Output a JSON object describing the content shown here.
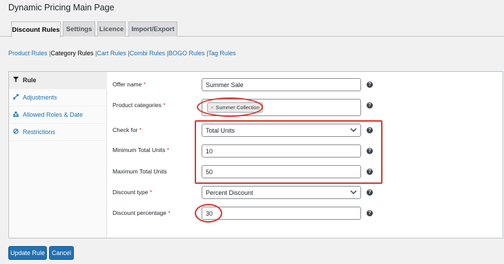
{
  "page_title": "Dynamic Pricing Main Page",
  "tabs": [
    {
      "label": "Discount Rules",
      "active": true
    },
    {
      "label": "Settings",
      "active": false
    },
    {
      "label": "Licence",
      "active": false
    },
    {
      "label": "Import/Export",
      "active": false
    }
  ],
  "subnav": {
    "product": "Product Rules",
    "category": "Category Rules",
    "cart": "Cart Rules",
    "combi": "Combi Rules",
    "bogo": "BOGO Rules",
    "tag": "Tag Rules",
    "separator": "|"
  },
  "sidebar": {
    "items": [
      {
        "label": "Rule",
        "icon": "filter-icon"
      },
      {
        "label": "Adjustments",
        "icon": "arrows-icon"
      },
      {
        "label": "Allowed Roles & Date",
        "icon": "users-icon"
      },
      {
        "label": "Restrictions",
        "icon": "ban-icon"
      }
    ]
  },
  "form": {
    "required_mark": "*",
    "help_glyph": "?",
    "offer_name": {
      "label": "Offer name",
      "value": "Summer Sale"
    },
    "product_categories": {
      "label": "Product categories",
      "tag": "Summer Collection",
      "remove": "×"
    },
    "check_for": {
      "label": "Check for",
      "value": "Total Units"
    },
    "min_units": {
      "label": "Minimum Total Units",
      "value": "10"
    },
    "max_units": {
      "label": "Maximum Total Units",
      "value": "50"
    },
    "discount_type": {
      "label": "Discount type",
      "value": "Percent Discount"
    },
    "discount_percentage": {
      "label": "Discount percentage",
      "value": "30"
    }
  },
  "buttons": {
    "update": "Update Rule",
    "cancel": "Cancel"
  },
  "colors": {
    "accent": "#2271b1",
    "annotation": "#d9352c",
    "required": "#d63638"
  }
}
